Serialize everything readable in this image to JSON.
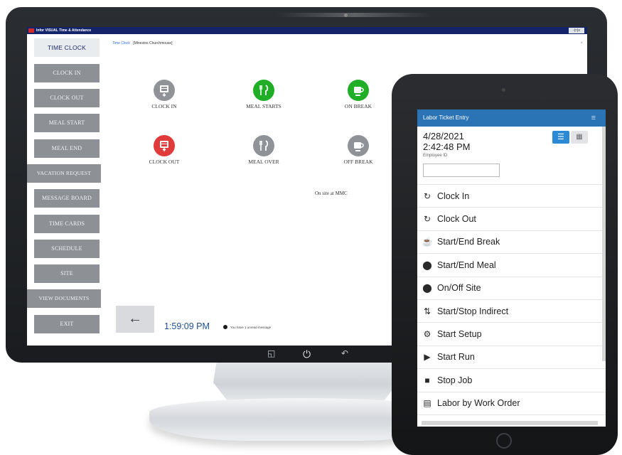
{
  "desktop": {
    "window_title": "Infor VISUAL Time & Attendance",
    "window_controls": "-|□|x",
    "breadcrumb": {
      "link": "Time Clock",
      "current": "[Mlnestos Churchmouse]"
    },
    "close_glyph": "×",
    "sidebar": [
      "TIME CLOCK",
      "CLOCK IN",
      "CLOCK OUT",
      "MEAL START",
      "MEAL END",
      "VACATION REQUEST",
      "MESSAGE BOARD",
      "TIME CARDS",
      "SCHEDULE",
      "SITE",
      "VIEW DOCUMENTS",
      "EXIT"
    ],
    "tiles": [
      {
        "label": "CLOCK IN",
        "icon": "clock-in-icon",
        "color": "#8f9398"
      },
      {
        "label": "MEAL STARTS",
        "icon": "meal-start-icon",
        "color": "#1fae26"
      },
      {
        "label": "ON BREAK",
        "icon": "coffee-icon",
        "color": "#1fae26"
      },
      {
        "label": "CLOCK OUT",
        "icon": "clock-out-icon",
        "color": "#e13a3a"
      },
      {
        "label": "MEAL OVER",
        "icon": "meal-over-icon",
        "color": "#8f9398"
      },
      {
        "label": "OFF BREAK",
        "icon": "coffee-off-icon",
        "color": "#8f9398"
      }
    ],
    "onsite_text": "On site at MMC",
    "back_glyph": "←",
    "clock_time": "1:59:09 PM",
    "message_text": "You have 1 unread message",
    "monitor_buttons": [
      "◱",
      "⏻",
      "↶"
    ]
  },
  "tablet": {
    "header_title": "Labor Ticket Entry",
    "menu_glyph": "≡",
    "date": "4/28/2021",
    "time": "2:42:48 PM",
    "employee_label": "Employee ID",
    "employee_value": "",
    "view_list_glyph": "☰",
    "view_grid_glyph": "▦",
    "items": [
      {
        "label": "Clock In",
        "icon": "clock-in-icon",
        "glyph": "↻"
      },
      {
        "label": "Clock Out",
        "icon": "clock-out-icon",
        "glyph": "↻"
      },
      {
        "label": "Start/End Break",
        "icon": "break-icon",
        "glyph": "☕"
      },
      {
        "label": "Start/End Meal",
        "icon": "meal-icon",
        "glyph": "⬤"
      },
      {
        "label": "On/Off Site",
        "icon": "site-icon",
        "glyph": "⬤"
      },
      {
        "label": "Start/Stop Indirect",
        "icon": "indirect-icon",
        "glyph": "⇅"
      },
      {
        "label": "Start Setup",
        "icon": "gear-icon",
        "glyph": "⚙"
      },
      {
        "label": "Start Run",
        "icon": "play-icon",
        "glyph": "▶"
      },
      {
        "label": "Stop Job",
        "icon": "stop-icon",
        "glyph": "■"
      },
      {
        "label": "Labor by Work Order",
        "icon": "work-order-icon",
        "glyph": "▤"
      }
    ]
  }
}
